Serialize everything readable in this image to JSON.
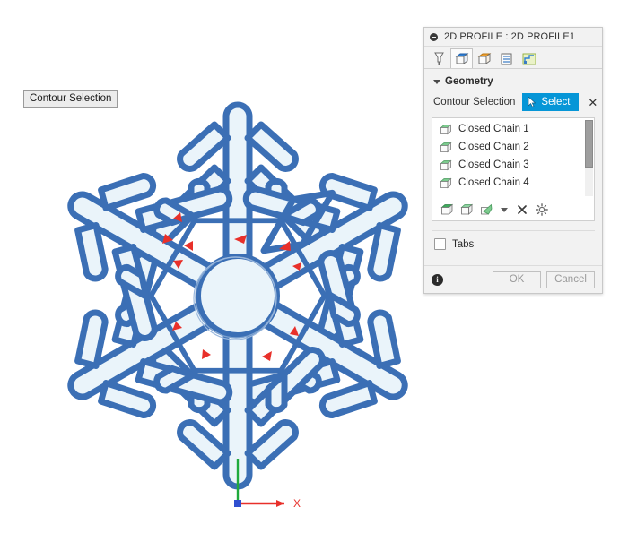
{
  "viewport": {
    "tooltip": "Contour Selection",
    "origin_axis_x_label": "X"
  },
  "dialog": {
    "title": "2D PROFILE : 2D PROFILE1",
    "collapse_icon": "collapse-minus-icon",
    "tabs": [
      {
        "name": "tool-tab",
        "icon": "tool-icon",
        "active": false
      },
      {
        "name": "geometry-tab",
        "icon": "geometry-box-icon",
        "active": true
      },
      {
        "name": "heights-tab",
        "icon": "heights-box-icon",
        "active": false
      },
      {
        "name": "passes-tab",
        "icon": "passes-icon",
        "active": false
      },
      {
        "name": "linking-tab",
        "icon": "linking-icon",
        "active": false
      }
    ],
    "geometry": {
      "section_label": "Geometry",
      "contour_selection_label": "Contour Selection",
      "select_button_label": "Select",
      "select_button_icon": "cursor-arrow-icon",
      "clear_icon": "close-x-icon",
      "chains": [
        {
          "label": "Closed Chain 1",
          "icon": "closed-chain-icon"
        },
        {
          "label": "Closed Chain 2",
          "icon": "closed-chain-icon"
        },
        {
          "label": "Closed Chain 3",
          "icon": "closed-chain-icon"
        },
        {
          "label": "Closed Chain 4",
          "icon": "closed-chain-icon"
        }
      ],
      "list_toolbar": [
        {
          "name": "add-chain-button",
          "icon": "chain-solid-icon"
        },
        {
          "name": "add-open-chain-button",
          "icon": "chain-outline-icon"
        },
        {
          "name": "add-face-button",
          "icon": "chain-face-icon"
        },
        {
          "name": "more-options-dropdown",
          "icon": "chevron-down-icon"
        },
        {
          "name": "delete-selection-button",
          "icon": "close-x-icon"
        },
        {
          "name": "chain-settings-button",
          "icon": "gear-icon"
        }
      ]
    },
    "tabs_option": {
      "label": "Tabs",
      "checked": false
    },
    "footer": {
      "info_icon": "info-icon",
      "ok_label": "OK",
      "cancel_label": "Cancel"
    }
  },
  "colors": {
    "accent_blue": "#0696d7",
    "contour_stroke": "#3b6fb5",
    "contour_fill": "#eaf4fa",
    "arrow_red": "#e8302a",
    "axis_green": "#1faa3c",
    "panel_bg": "#f2f2f2"
  }
}
